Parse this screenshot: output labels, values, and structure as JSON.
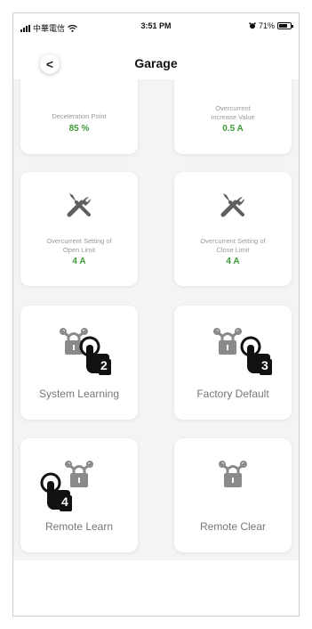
{
  "status_bar": {
    "carrier": "中華電信",
    "time": "3:51 PM",
    "battery_pct": "71%",
    "battery_level": 0.71
  },
  "nav": {
    "title": "Garage",
    "back_label": "<"
  },
  "cards": {
    "deceleration": {
      "label": "Deceleration Point",
      "value": "85 %"
    },
    "overcurrent_increase": {
      "label_line1": "Overcurrent",
      "label_line2": "Increase Value",
      "value": "0.5 A"
    },
    "open_limit": {
      "label_line1": "Overcurrent Setting of",
      "label_line2": "Open Limit",
      "value": "4 A"
    },
    "close_limit": {
      "label_line1": "Overcurrent Setting of",
      "label_line2": "Close Limit",
      "value": "4 A"
    },
    "system_learning": {
      "label": "System Learning",
      "step": "2"
    },
    "factory_default": {
      "label": "Factory Default",
      "step": "3"
    },
    "remote_learn": {
      "label": "Remote Learn",
      "step": "4"
    },
    "remote_clear": {
      "label": "Remote Clear"
    }
  },
  "icons": [
    "tools-icon",
    "padlock-chain-icon",
    "tap-hand-icon",
    "signal-icon",
    "wifi-icon",
    "alarm-icon",
    "battery-icon"
  ]
}
